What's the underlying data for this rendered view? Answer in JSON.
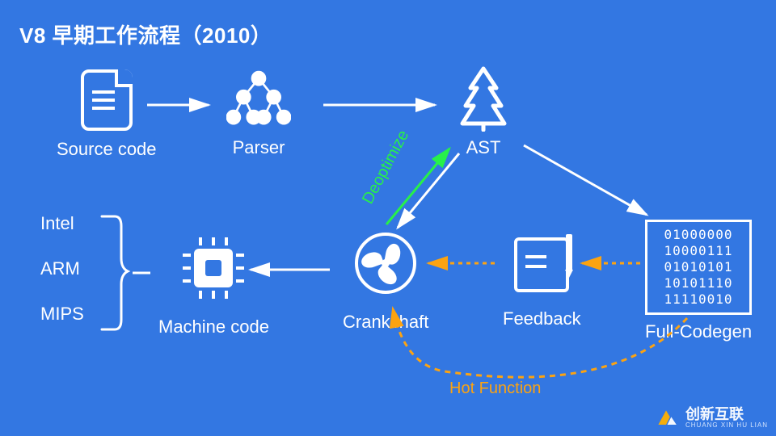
{
  "title": "V8 早期工作流程（2010）",
  "nodes": {
    "source_code": {
      "label": "Source code"
    },
    "parser": {
      "label": "Parser"
    },
    "ast": {
      "label": "AST"
    },
    "machine_code": {
      "label": "Machine code"
    },
    "crankshaft": {
      "label": "Crankshaft"
    },
    "feedback": {
      "label": "Feedback"
    },
    "full_codegen": {
      "label": "Full-Codegen"
    }
  },
  "architectures": [
    "Intel",
    "ARM",
    "MIPS"
  ],
  "binary_lines": [
    "01000000",
    "10000111",
    "01010101",
    "10101110",
    "11110010"
  ],
  "edge_labels": {
    "deoptimize": "Deoptimize",
    "hot_function": "Hot Function"
  },
  "colors": {
    "background": "#3377e2",
    "accent_green": "#27f04a",
    "accent_orange": "#fca311"
  },
  "watermark": {
    "brand_cn": "创新互联",
    "brand_en": "CHUANG XIN HU LIAN"
  }
}
